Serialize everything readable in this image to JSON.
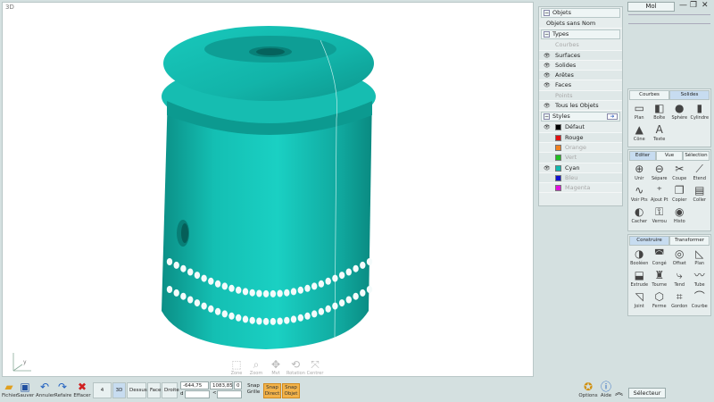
{
  "viewport": {
    "label": "3D",
    "axis_y": "y",
    "model_color": "#11b7ab",
    "nav_tools": [
      {
        "name": "zoom-tool",
        "label": "Zone",
        "icon": "zoom-box-icon"
      },
      {
        "name": "zoom-magnifier",
        "label": "Zoom",
        "icon": "magnifier-icon"
      },
      {
        "name": "move-tool",
        "label": "Mvt",
        "icon": "move-icon"
      },
      {
        "name": "rotation-tool",
        "label": "Rotation",
        "icon": "rotate-icon"
      },
      {
        "name": "center-tool",
        "label": "Centrer",
        "icon": "center-icon"
      }
    ]
  },
  "toolbar": {
    "fichier": "Fichier",
    "sauver": "Sauver",
    "annuler": "Annuler",
    "refaire": "Refaire",
    "effacer": "Effacer",
    "views": [
      "4 Vues",
      "3D",
      "Dessus",
      "Face",
      "Droite"
    ],
    "active_view": "3D",
    "coord_x": "-644,75",
    "coord_y": "1083,85",
    "coord_z": "0",
    "coord_d_label": "d",
    "coord_angle_label": "<",
    "snap_grille": [
      "Snap",
      "Grille"
    ],
    "snap_direct": [
      "Snap",
      "Direct"
    ],
    "snap_objet": [
      "Snap",
      "Objet"
    ],
    "options": "Options",
    "aide": "Aide",
    "selecteur": "Sélecteur"
  },
  "top_right": {
    "mode": "Mol"
  },
  "objects_panel": {
    "objets_header": "Objets",
    "objets_item": "Objets sans Nom",
    "types_header": "Types",
    "types": [
      {
        "label": "Courbes",
        "eye": false,
        "dim": true
      },
      {
        "label": "Surfaces",
        "eye": true,
        "dim": false
      },
      {
        "label": "Solides",
        "eye": true,
        "dim": false
      },
      {
        "label": "Arêtes",
        "eye": true,
        "dim": false
      },
      {
        "label": "Faces",
        "eye": true,
        "dim": false
      },
      {
        "label": "Points",
        "eye": false,
        "dim": true
      },
      {
        "label": "Tous les Objets",
        "eye": true,
        "dim": false
      }
    ],
    "styles_header": "Styles",
    "styles": [
      {
        "label": "Défaut",
        "color": "#000000",
        "eye": true,
        "dim": false
      },
      {
        "label": "Rouge",
        "color": "#e01010",
        "eye": false,
        "dim": false
      },
      {
        "label": "Orange",
        "color": "#f08020",
        "eye": false,
        "dim": true
      },
      {
        "label": "Vert",
        "color": "#20c020",
        "eye": false,
        "dim": true
      },
      {
        "label": "Cyan",
        "color": "#10b8b0",
        "eye": true,
        "dim": false
      },
      {
        "label": "Bleu",
        "color": "#1010d0",
        "eye": false,
        "dim": true
      },
      {
        "label": "Magenta",
        "color": "#e010e0",
        "eye": false,
        "dim": true
      }
    ]
  },
  "panel_create": {
    "tabs": [
      "Courbes",
      "Solides"
    ],
    "active": "Solides",
    "tools": [
      {
        "label": "Plan",
        "icon": "plane-icon",
        "glyph": "▭"
      },
      {
        "label": "Boîte",
        "icon": "box-icon",
        "glyph": "◧"
      },
      {
        "label": "Sphère",
        "icon": "sphere-icon",
        "glyph": "●"
      },
      {
        "label": "Cylindre",
        "icon": "cylinder-icon",
        "glyph": "▮"
      },
      {
        "label": "Cône",
        "icon": "cone-icon",
        "glyph": "▲"
      },
      {
        "label": "Texte",
        "icon": "text-icon",
        "glyph": "A"
      }
    ]
  },
  "panel_edit": {
    "tabs": [
      "Editer",
      "Vue",
      "Sélection"
    ],
    "active": "Editer",
    "tools": [
      {
        "label": "Unir",
        "icon": "join-icon",
        "glyph": "⊕"
      },
      {
        "label": "Sépare",
        "icon": "separate-icon",
        "glyph": "⊖"
      },
      {
        "label": "Coupe",
        "icon": "trim-icon",
        "glyph": "✂"
      },
      {
        "label": "Etend",
        "icon": "extend-icon",
        "glyph": "⟋"
      },
      {
        "label": "Voir Pts",
        "icon": "show-points-icon",
        "glyph": "∿"
      },
      {
        "label": "Ajout Pt",
        "icon": "add-point-icon",
        "glyph": "⁺"
      },
      {
        "label": "Copier",
        "icon": "copy-icon",
        "glyph": "❐"
      },
      {
        "label": "Coller",
        "icon": "paste-icon",
        "glyph": "▤"
      },
      {
        "label": "Cacher",
        "icon": "hide-icon",
        "glyph": "◐"
      },
      {
        "label": "Verrou",
        "icon": "lock-icon",
        "glyph": "⚿"
      },
      {
        "label": "Histo",
        "icon": "history-icon",
        "glyph": "◉"
      }
    ]
  },
  "panel_build": {
    "tabs": [
      "Construire",
      "Transformer"
    ],
    "active": "Construire",
    "tools": [
      {
        "label": "Booléen",
        "icon": "boolean-icon",
        "glyph": "◑"
      },
      {
        "label": "Congé",
        "icon": "fillet-icon",
        "glyph": "◚"
      },
      {
        "label": "Offset",
        "icon": "offset-icon",
        "glyph": "◎"
      },
      {
        "label": "Plan",
        "icon": "plane-build-icon",
        "glyph": "◺"
      },
      {
        "label": "Extrude",
        "icon": "extrude-icon",
        "glyph": "⬓"
      },
      {
        "label": "Tourne",
        "icon": "revolve-icon",
        "glyph": "♜"
      },
      {
        "label": "Tend",
        "icon": "sweep-icon",
        "glyph": "⤷"
      },
      {
        "label": "Tube",
        "icon": "tube-icon",
        "glyph": "〰"
      },
      {
        "label": "Joint",
        "icon": "blend-icon",
        "glyph": "◹"
      },
      {
        "label": "Ferme",
        "icon": "network-icon",
        "glyph": "⬡"
      },
      {
        "label": "Gordon",
        "icon": "gordon-icon",
        "glyph": "⌗"
      },
      {
        "label": "Courbe",
        "icon": "curve-icon",
        "glyph": "⌒"
      }
    ]
  }
}
